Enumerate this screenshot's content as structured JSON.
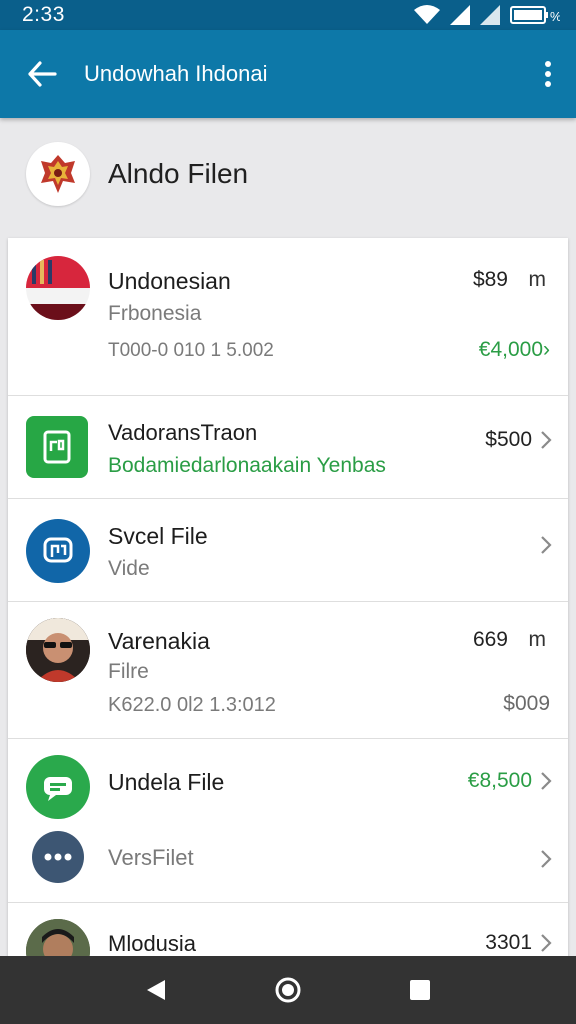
{
  "status_bar": {
    "time": "2:33"
  },
  "app_bar": {
    "title": "Undowhah Ihdonai"
  },
  "account": {
    "name": "Alndo Filen"
  },
  "rows": [
    {
      "title": "Undonesian",
      "subtitle": "Frbonesia",
      "detail": "T000-0 010 1 5.002",
      "amount": "$89",
      "unit": "m",
      "secondary_amount": "€4,000›",
      "avatar": "indonesia-flag-icon"
    },
    {
      "title": "VadoransTraon",
      "subtitle": "Bodamiedarlonaakain Yenbas",
      "amount": "$500",
      "avatar": "document-app-icon"
    },
    {
      "title": "Svcel File",
      "subtitle": "Vide",
      "avatar": "chat-app-icon"
    },
    {
      "title": "Varenakia",
      "subtitle": "Filre",
      "detail": "K622.0 0l2 1.3:012",
      "amount": "669",
      "unit": "m",
      "secondary_amount": "$009",
      "avatar": "person-avatar"
    },
    {
      "title": "Undela File",
      "amount": "€8,500",
      "avatar": "message-app-icon"
    },
    {
      "title": "VersFilet",
      "avatar": "more-dots-icon"
    },
    {
      "title": "Mlodusia",
      "amount": "3301",
      "avatar": "person-avatar"
    }
  ],
  "colors": {
    "status_bar": "#0a5f8b",
    "app_bar": "#0d78a8",
    "green": "#2a9d45",
    "nav_bar": "#333333"
  }
}
